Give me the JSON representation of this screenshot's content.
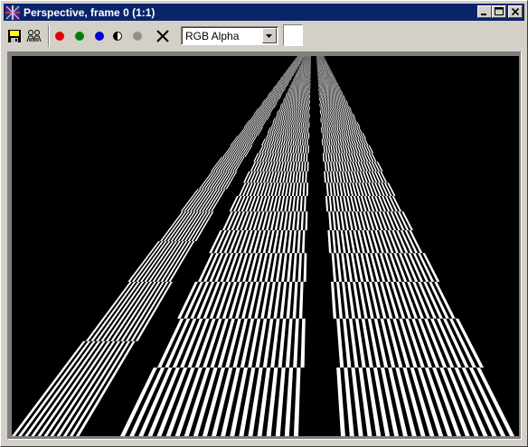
{
  "window": {
    "title": "Perspective, frame 0 (1:1)",
    "title_bar_color": "#0a246a",
    "icon": "perspective-star-icon"
  },
  "title_buttons": {
    "minimize_icon": "minimize-icon",
    "maximize_icon": "maximize-icon",
    "close_icon": "close-icon"
  },
  "toolbar": {
    "save_icon": "save-disk-icon",
    "people_icon": "people-icon",
    "channel_red_color": "#e00000",
    "channel_green_color": "#008000",
    "channel_blue_color": "#0000d0",
    "channel_mono_icon": "half-circle-icon",
    "channel_alpha_color": "#909090",
    "clear_icon": "x-icon",
    "channel_select_value": "RGB Alpha",
    "swatch_color": "#ffffff"
  },
  "viewport": {
    "background_color": "#000000",
    "image_description_icon": "checkerboard-perspective-image"
  }
}
